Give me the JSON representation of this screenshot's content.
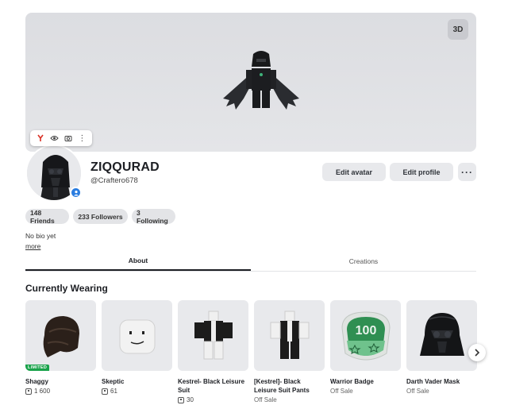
{
  "banner": {
    "view_3d_label": "3D"
  },
  "mini_toolbar": {
    "icons": [
      "yandex-icon",
      "eye-icon",
      "camera-icon",
      "kebab-menu-icon"
    ]
  },
  "profile": {
    "display_name": "ZIQQURAD",
    "username": "@Craftero678",
    "bio": "No bio yet",
    "more_label": "more"
  },
  "actions": {
    "edit_avatar": "Edit avatar",
    "edit_profile": "Edit profile",
    "more": "···"
  },
  "stats": {
    "friends": "148 Friends",
    "followers": "233 Followers",
    "following": "3 Following"
  },
  "tabs": [
    {
      "label": "About",
      "active": true
    },
    {
      "label": "Creations",
      "active": false
    }
  ],
  "wearing": {
    "title": "Currently Wearing",
    "items": [
      {
        "name": "Shaggy",
        "price": "1 600",
        "badge": "LIMITED",
        "icon": "hair-icon"
      },
      {
        "name": "Skeptic",
        "price": "61",
        "icon": "face-icon"
      },
      {
        "name": "Kestrel- Black Leisure Suit",
        "price": "30",
        "icon": "shirt-icon"
      },
      {
        "name": "[Kestrel]- Black Leisure Suit Pants",
        "offsale": "Off Sale",
        "icon": "pants-icon"
      },
      {
        "name": "Warrior Badge",
        "offsale": "Off Sale",
        "icon": "badge-icon",
        "badge_number": "100"
      },
      {
        "name": "Darth Vader Mask",
        "offsale": "Off Sale",
        "icon": "helmet-icon"
      }
    ]
  },
  "colors": {
    "limited": "#19a24a",
    "online": "#2b7de0",
    "badge_green": "#2f8f52"
  }
}
